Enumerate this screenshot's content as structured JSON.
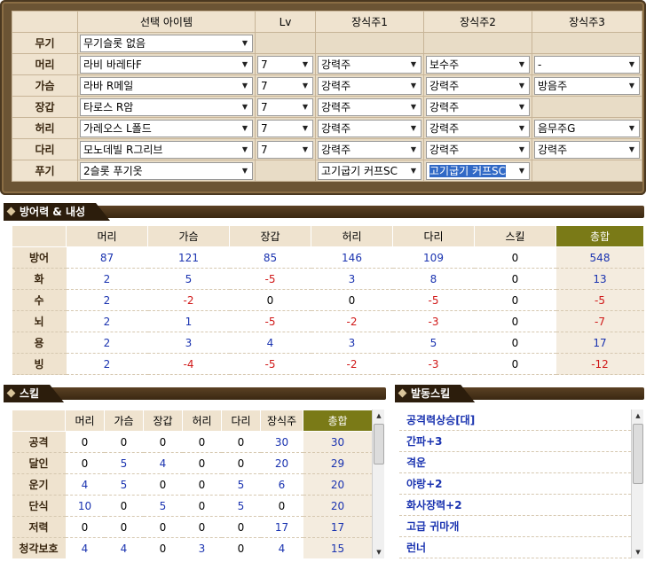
{
  "equipment": {
    "headers": {
      "item": "선택 아이템",
      "lv": "Lv",
      "deco1": "장식주1",
      "deco2": "장식주2",
      "deco3": "장식주3"
    },
    "rows": [
      {
        "slot": "무기",
        "item": "무기슬롯 없음",
        "lv": null,
        "deco1": null,
        "deco2": null,
        "deco3": null
      },
      {
        "slot": "머리",
        "item": "라비 바레타F",
        "lv": "7",
        "deco1": "강력주",
        "deco2": "보수주",
        "deco3": "-"
      },
      {
        "slot": "가슴",
        "item": "라바 R메일",
        "lv": "7",
        "deco1": "강력주",
        "deco2": "강력주",
        "deco3": "방음주"
      },
      {
        "slot": "장갑",
        "item": "타로스 R암",
        "lv": "7",
        "deco1": "강력주",
        "deco2": "강력주",
        "deco3": null
      },
      {
        "slot": "허리",
        "item": "가레오스 L폴드",
        "lv": "7",
        "deco1": "강력주",
        "deco2": "강력주",
        "deco3": "음무주G"
      },
      {
        "slot": "다리",
        "item": "모노데빌 R그리브",
        "lv": "7",
        "deco1": "강력주",
        "deco2": "강력주",
        "deco3": "강력주"
      },
      {
        "slot": "푸기",
        "item": "2슬롯 푸기옷",
        "lv": null,
        "deco1": "고기굽기 커프SC",
        "deco2": "고기굽기 커프SC",
        "deco3": null
      }
    ]
  },
  "defense": {
    "title": "방어력 & 내성",
    "columns": [
      "머리",
      "가슴",
      "장갑",
      "허리",
      "다리",
      "스킬",
      "총합"
    ],
    "rows": [
      {
        "label": "방어",
        "values": [
          "87",
          "121",
          "85",
          "146",
          "109",
          "0",
          "548"
        ]
      },
      {
        "label": "화",
        "values": [
          "2",
          "5",
          "-5",
          "3",
          "8",
          "0",
          "13"
        ]
      },
      {
        "label": "수",
        "values": [
          "2",
          "-2",
          "0",
          "0",
          "-5",
          "0",
          "-5"
        ]
      },
      {
        "label": "뇌",
        "values": [
          "2",
          "1",
          "-5",
          "-2",
          "-3",
          "0",
          "-7"
        ]
      },
      {
        "label": "용",
        "values": [
          "2",
          "3",
          "4",
          "3",
          "5",
          "0",
          "17"
        ]
      },
      {
        "label": "빙",
        "values": [
          "2",
          "-4",
          "-5",
          "-2",
          "-3",
          "0",
          "-12"
        ]
      }
    ]
  },
  "skills": {
    "title": "스킬",
    "columns": [
      "머리",
      "가슴",
      "장갑",
      "허리",
      "다리",
      "장식주",
      "총합"
    ],
    "rows": [
      {
        "label": "공격",
        "values": [
          "0",
          "0",
          "0",
          "0",
          "0",
          "30",
          "30"
        ]
      },
      {
        "label": "달인",
        "values": [
          "0",
          "5",
          "4",
          "0",
          "0",
          "20",
          "29"
        ]
      },
      {
        "label": "운기",
        "values": [
          "4",
          "5",
          "0",
          "0",
          "5",
          "6",
          "20"
        ]
      },
      {
        "label": "단식",
        "values": [
          "10",
          "0",
          "5",
          "0",
          "5",
          "0",
          "20"
        ]
      },
      {
        "label": "저력",
        "values": [
          "0",
          "0",
          "0",
          "0",
          "0",
          "17",
          "17"
        ]
      },
      {
        "label": "청각보호",
        "values": [
          "4",
          "4",
          "0",
          "3",
          "0",
          "4",
          "15"
        ]
      }
    ]
  },
  "active_skills": {
    "title": "발동스킬",
    "items": [
      "공격력상승[대]",
      "간파+3",
      "격운",
      "야랑+2",
      "화사장력+2",
      "고급 귀마개",
      "런너"
    ]
  },
  "colors": {
    "positive": "#1a33b0",
    "negative": "#d01818",
    "total_header": "#7a7a17",
    "frame": "#6b5434"
  }
}
